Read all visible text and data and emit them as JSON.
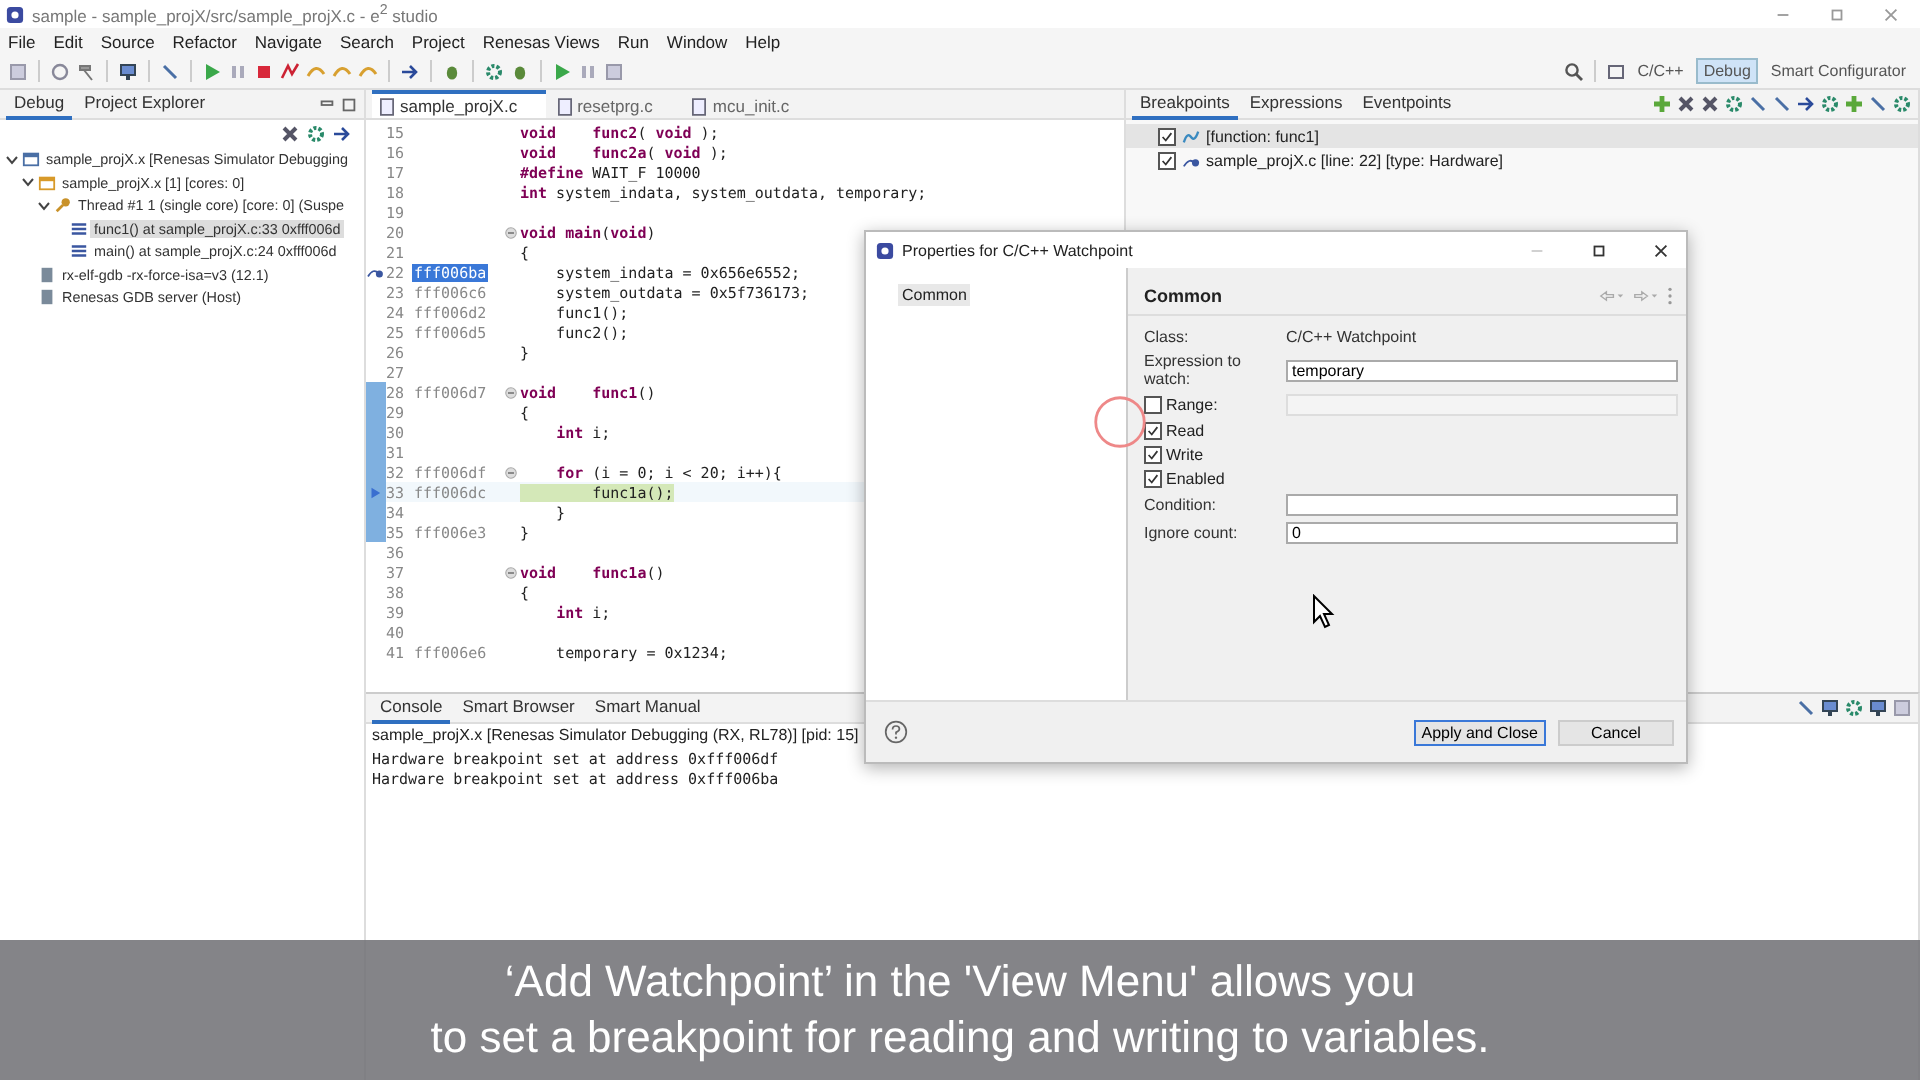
{
  "window": {
    "title": "sample - sample_projX/src/sample_projX.c - e$^{2}$ studio"
  },
  "menu": [
    "File",
    "Edit",
    "Source",
    "Refactor",
    "Navigate",
    "Search",
    "Project",
    "Renesas Views",
    "Run",
    "Window",
    "Help"
  ],
  "perspectives": [
    {
      "label": "C/C++",
      "selected": false
    },
    {
      "label": "Debug",
      "selected": true
    },
    {
      "label": "Smart Configurator",
      "selected": false
    }
  ],
  "debug_view": {
    "tabs": [
      {
        "label": "Debug",
        "selected": true
      },
      {
        "label": "Project Explorer",
        "selected": false
      }
    ],
    "tree": [
      {
        "label": "sample_projX.x [Renesas Simulator Debugging",
        "kind": "launch",
        "expanded": true,
        "selected": false,
        "children": [
          {
            "label": "sample_projX.x [1] [cores: 0]",
            "kind": "process",
            "expanded": true,
            "selected": false,
            "children": [
              {
                "label": "Thread #1 1 (single core) [core: 0] (Suspe",
                "kind": "thread",
                "expanded": true,
                "selected": false,
                "children": [
                  {
                    "label": "func1() at sample_projX.c:33 0xfff006d",
                    "kind": "frame",
                    "selected": true
                  },
                  {
                    "label": "main() at sample_projX.c:24 0xfff006d",
                    "kind": "frame",
                    "selected": false
                  }
                ]
              }
            ]
          },
          {
            "label": "rx-elf-gdb -rx-force-isa=v3 (12.1)",
            "kind": "debugger",
            "selected": false
          },
          {
            "label": "Renesas GDB server (Host)",
            "kind": "debugger",
            "selected": false
          }
        ]
      }
    ]
  },
  "editor": {
    "tabs": [
      {
        "label": "sample_projX.c",
        "selected": true
      },
      {
        "label": "resetprg.c",
        "selected": false
      },
      {
        "label": "mcu_init.c",
        "selected": false
      }
    ],
    "lines": [
      {
        "number": "15",
        "kind": "plain",
        "code": "**void**    **func2**( **void** );",
        "fold": false,
        "in_range": false,
        "current": false,
        "selected": false
      },
      {
        "number": "16",
        "kind": "plain",
        "code": "**void**    **func2a**( **void** );",
        "fold": false,
        "in_range": false,
        "current": false,
        "selected": false
      },
      {
        "number": "17",
        "kind": "plain",
        "code": "**#define** WAIT_F 10000",
        "fold": false,
        "in_range": false,
        "current": false,
        "selected": false
      },
      {
        "number": "18",
        "kind": "plain",
        "code": "**int** system_indata, system_outdata, temporary;",
        "fold": false,
        "in_range": false,
        "current": false,
        "selected": false
      },
      {
        "number": "19",
        "kind": "plain",
        "fold": false,
        "in_range": false,
        "current": false,
        "selected": false
      },
      {
        "number": "20",
        "kind": "plain",
        "code": "**void** **main**(**void**)",
        "fold": true,
        "in_range": false,
        "current": false,
        "selected": false
      },
      {
        "number": "21",
        "kind": "plain",
        "code": "{",
        "fold": false,
        "in_range": false,
        "current": false,
        "selected": false
      },
      {
        "number": "22",
        "kind": "breakpoint",
        "address": "fff006ba",
        "code": "    system_indata = 0x656e6552;",
        "fold": false,
        "in_range": false,
        "current": false,
        "selected": true
      },
      {
        "number": "23",
        "kind": "plain",
        "address": "fff006c6",
        "code": "    system_outdata = 0x5f736173;",
        "fold": false,
        "in_range": false,
        "current": false,
        "selected": false
      },
      {
        "number": "24",
        "kind": "plain",
        "address": "fff006d2",
        "code": "    func1();",
        "fold": false,
        "in_range": false,
        "current": false,
        "selected": false
      },
      {
        "number": "25",
        "kind": "plain",
        "address": "fff006d5",
        "code": "    func2();",
        "fold": false,
        "in_range": false,
        "current": false,
        "selected": false
      },
      {
        "number": "26",
        "kind": "plain",
        "code": "}",
        "fold": false,
        "in_range": false,
        "current": false,
        "selected": false
      },
      {
        "number": "27",
        "kind": "plain",
        "fold": false,
        "in_range": false,
        "current": false,
        "selected": false
      },
      {
        "number": "28",
        "kind": "plain",
        "address": "fff006d7",
        "code": "**void**    **func1**()",
        "fold": true,
        "in_range": true,
        "current": false,
        "selected": false
      },
      {
        "number": "29",
        "kind": "plain",
        "code": "{",
        "fold": false,
        "in_range": true,
        "current": false,
        "selected": false
      },
      {
        "number": "30",
        "kind": "plain",
        "code": "    **int** i;",
        "fold": false,
        "in_range": true,
        "current": false,
        "selected": false
      },
      {
        "number": "31",
        "kind": "plain",
        "fold": false,
        "in_range": true,
        "current": false,
        "selected": false
      },
      {
        "number": "32",
        "kind": "plain",
        "address": "fff006df",
        "code": "    **for** (i = 0; i < 20; i++){",
        "fold": true,
        "in_range": true,
        "current": false,
        "selected": false
      },
      {
        "number": "33",
        "kind": "pc",
        "address": "fff006dc",
        "code": "        func1a();",
        "fold": false,
        "in_range": true,
        "current": true,
        "selected": false
      },
      {
        "number": "34",
        "kind": "plain",
        "code": "    }",
        "fold": false,
        "in_range": true,
        "current": false,
        "selected": false
      },
      {
        "number": "35",
        "kind": "plain",
        "address": "fff006e3",
        "code": "}",
        "fold": false,
        "in_range": true,
        "current": false,
        "selected": false
      },
      {
        "number": "36",
        "kind": "plain",
        "fold": false,
        "in_range": false,
        "current": false,
        "selected": false
      },
      {
        "number": "37",
        "kind": "plain",
        "code": "**void**    **func1a**()",
        "fold": true,
        "in_range": false,
        "current": false,
        "selected": false
      },
      {
        "number": "38",
        "kind": "plain",
        "code": "{",
        "fold": false,
        "in_range": false,
        "current": false,
        "selected": false
      },
      {
        "number": "39",
        "kind": "plain",
        "code": "    **int** i;",
        "fold": false,
        "in_range": false,
        "current": false,
        "selected": false
      },
      {
        "number": "40",
        "kind": "plain",
        "fold": false,
        "in_range": false,
        "current": false,
        "selected": false
      },
      {
        "number": "41",
        "kind": "plain",
        "address": "fff006e6",
        "code": "    temporary = 0x1234;",
        "fold": false,
        "in_range": false,
        "current": false,
        "selected": false
      }
    ]
  },
  "breakpoints_view": {
    "tabs": [
      {
        "label": "Breakpoints",
        "selected": true
      },
      {
        "label": "Expressions",
        "selected": false
      },
      {
        "label": "Eventpoints",
        "selected": false
      }
    ],
    "items": [
      {
        "label": "[function: func1]",
        "checked": true,
        "selected": true,
        "kind": "function"
      },
      {
        "label": "sample_projX.c [line: 22] [type: Hardware]",
        "checked": true,
        "selected": false,
        "kind": "line"
      }
    ]
  },
  "console": {
    "tabs": [
      {
        "label": "Console",
        "selected": true
      },
      {
        "label": "Smart Browser",
        "selected": false
      },
      {
        "label": "Smart Manual",
        "selected": false
      }
    ],
    "header": "sample_projX.x [Renesas Simulator Debugging (RX, RL78)]  [pid: 15]",
    "lines": [
      "Hardware breakpoint set at address 0xfff006df",
      "Hardware breakpoint set at address 0xfff006ba"
    ]
  },
  "dialog": {
    "title": "Properties for C/C++ Watchpoint",
    "pages": [
      {
        "label": "Common",
        "selected": true
      }
    ],
    "heading": "Common",
    "class_label": "Class:",
    "class_value": "C/C++ Watchpoint",
    "expression": {
      "label": "Expression to watch:",
      "value": "temporary"
    },
    "range": {
      "label": "Range:",
      "checked": false
    },
    "options": [
      {
        "label": "Read",
        "checked": true
      },
      {
        "label": "Write",
        "checked": true
      },
      {
        "label": "Enabled",
        "checked": true
      }
    ],
    "condition": {
      "label": "Condition:"
    },
    "ignore_count": {
      "label": "Ignore count:",
      "value": "0"
    },
    "buttons": [
      {
        "label": "Apply and Close",
        "default": true
      },
      {
        "label": "Cancel",
        "default": false
      }
    ]
  },
  "caption": [
    "‘Add Watchpoint’ in the 'View Menu' allows you",
    "to set a breakpoint for reading and writing to variables."
  ]
}
